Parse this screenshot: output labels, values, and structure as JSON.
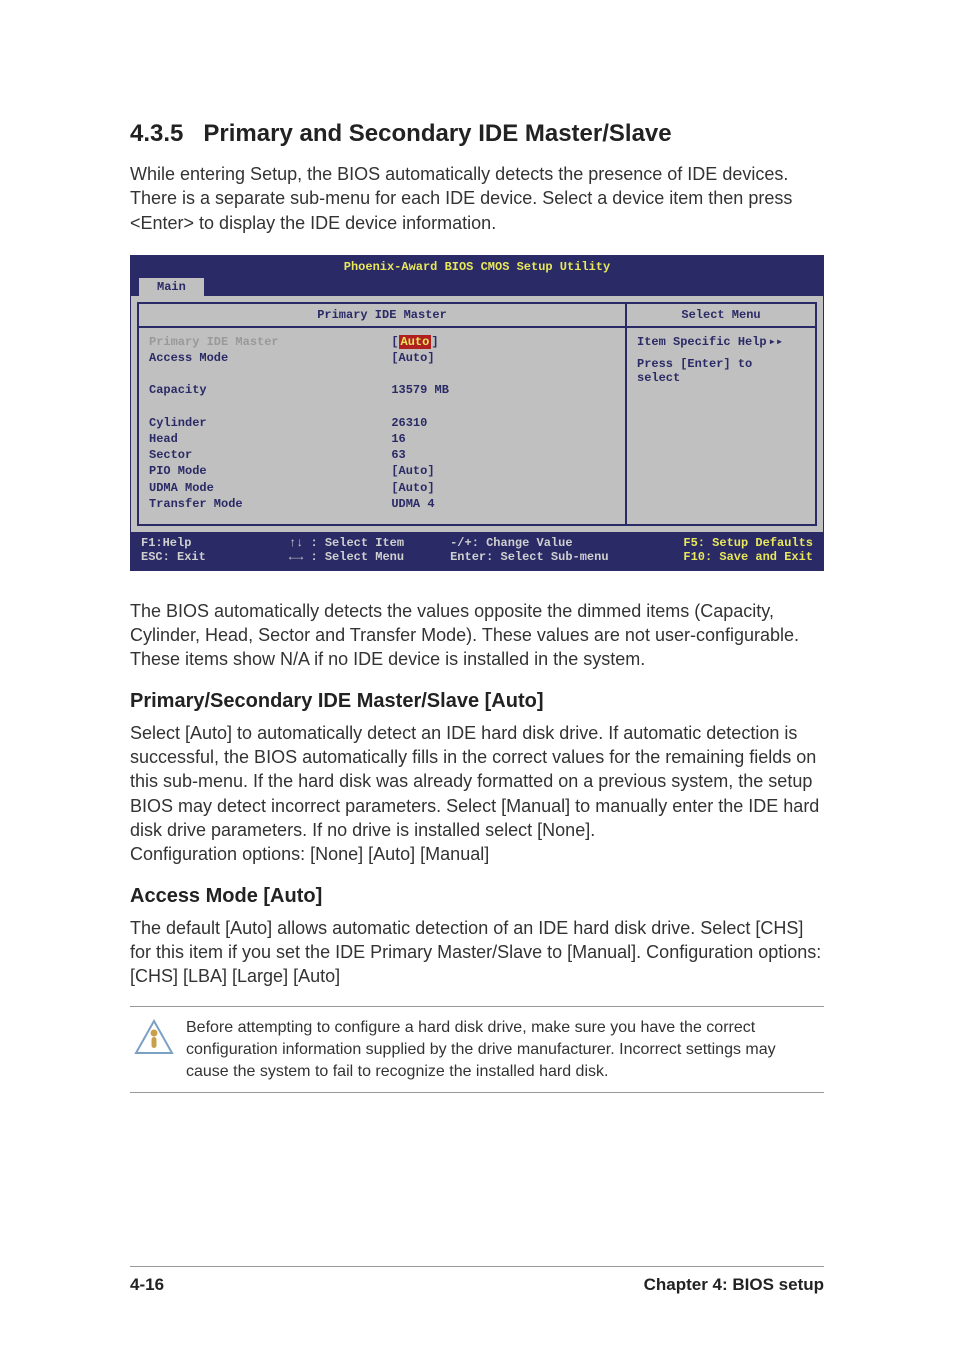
{
  "section": {
    "number": "4.3.5",
    "title": "Primary and Secondary IDE Master/Slave",
    "intro": "While entering Setup, the BIOS automatically detects the presence of IDE devices. There is a separate sub-menu for each IDE device. Select a device item then press <Enter> to display the IDE device information."
  },
  "bios": {
    "title": "Phoenix-Award BIOS CMOS Setup Utility",
    "tab": "Main",
    "left_panel_title": "Primary IDE Master",
    "right_panel_title": "Select Menu",
    "rows": [
      {
        "label": "Primary IDE Master",
        "value": "Auto",
        "bracketed": true,
        "selected": true,
        "dimmed_label": true
      },
      {
        "label": "Access Mode",
        "value": "[Auto]"
      },
      {
        "spacer": true
      },
      {
        "label": "Capacity",
        "value": "13579 MB"
      },
      {
        "spacer": true
      },
      {
        "label": "Cylinder",
        "value": "26310"
      },
      {
        "label": "Head",
        "value": "  16"
      },
      {
        "label": "Sector",
        "value": "  63"
      },
      {
        "label": "PIO Mode",
        "value": "[Auto]"
      },
      {
        "label": "UDMA Mode",
        "value": "[Auto]"
      },
      {
        "label": "Transfer Mode",
        "value": "UDMA 4"
      }
    ],
    "help": {
      "title": "Item Specific Help",
      "text1": "Press [Enter] to",
      "text2": "select"
    },
    "footer": {
      "f1": "F1:Help",
      "select_item": ": Select Item",
      "change_value": "-/+: Change Value",
      "f5": "F5: Setup Defaults",
      "esc": "ESC: Exit",
      "select_menu": ": Select Menu",
      "enter_sub": "Enter: Select Sub-menu",
      "f10": "F10: Save and Exit"
    }
  },
  "para_after": "The BIOS automatically detects the values opposite the dimmed items (Capacity, Cylinder,  Head, Sector and Transfer Mode). These values are not user-configurable. These items show N/A if no IDE device is installed in the system.",
  "sub1": {
    "heading": "Primary/Secondary IDE Master/Slave [Auto]",
    "text": "Select [Auto] to automatically detect an IDE hard disk drive. If automatic detection is successful, the BIOS automatically fills in the correct values for the remaining fields on this sub-menu. If the hard disk was already formatted on a previous system, the setup BIOS may detect incorrect parameters. Select [Manual] to manually enter the IDE hard disk drive parameters. If no drive is installed select [None].\nConfiguration options: [None] [Auto] [Manual]"
  },
  "sub2": {
    "heading": "Access Mode [Auto]",
    "text": "The default [Auto] allows automatic detection of an IDE hard disk drive. Select [CHS] for this item if you set the IDE Primary Master/Slave to [Manual]. Configuration options: [CHS] [LBA] [Large] [Auto]"
  },
  "note": "Before attempting to configure a hard disk drive, make sure you have the correct configuration information supplied by the drive manufacturer. Incorrect settings may cause the system to fail to recognize the installed hard disk.",
  "footer": {
    "left": "4-16",
    "right": "Chapter 4: BIOS setup"
  }
}
